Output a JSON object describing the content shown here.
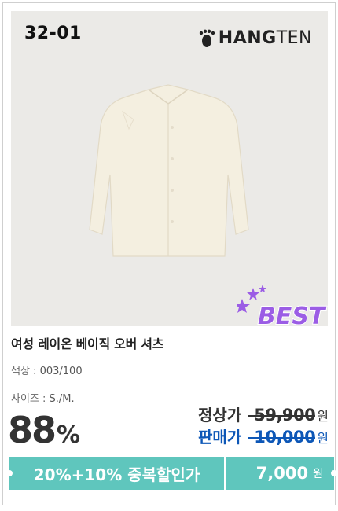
{
  "product": {
    "code": "32-01",
    "brand": "HANGTEN",
    "brand_bold": "HANG",
    "brand_light": "TEN",
    "badge": "BEST",
    "name": "여성 레이온 베이직 오버 셔츠",
    "color_label": "색상 :",
    "color_value": "003/100",
    "size_label": "사이즈 :",
    "size_value": "S./M."
  },
  "pricing": {
    "discount_number": "88",
    "discount_unit": "%",
    "regular_label": "정상가",
    "regular_price": "59,900",
    "regular_unit": "원",
    "sale_label": "판매가",
    "sale_price": "10,000",
    "sale_unit": "원"
  },
  "coupon": {
    "label": "20%+10% 중복할인가",
    "price": "7,000",
    "unit": "원"
  },
  "colors": {
    "accent_teal": "#5fc6bd",
    "sale_blue": "#0d57b7",
    "badge_purple": "#9b5de5"
  }
}
